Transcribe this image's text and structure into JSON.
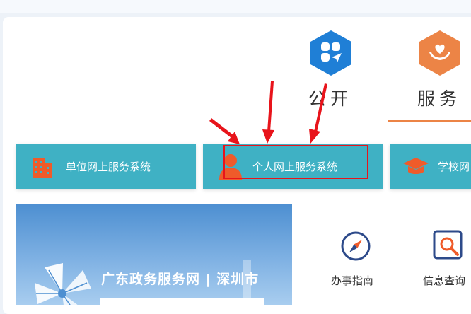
{
  "tabs": [
    {
      "label": "公开",
      "icon": "clover-send-icon",
      "color": "#1f7fd6"
    },
    {
      "label": "服务",
      "icon": "heart-hands-icon",
      "color": "#ec8446",
      "active": true
    }
  ],
  "services": [
    {
      "label": "单位网上服务系统",
      "icon": "building-icon"
    },
    {
      "label": "个人网上服务系统",
      "icon": "person-icon",
      "highlighted": true
    },
    {
      "label": "学校网",
      "icon": "graduation-cap-icon"
    }
  ],
  "banner": {
    "title": "广东政务服务网 | 深圳市"
  },
  "quick_links": [
    {
      "label": "办事指南",
      "icon": "compass-icon"
    },
    {
      "label": "信息查询",
      "icon": "search-doc-icon"
    }
  ],
  "colors": {
    "accent": "#ec8446",
    "service_bg": "#3fb1c4",
    "highlight": "#e8141b",
    "arrow": "#e8141b"
  }
}
